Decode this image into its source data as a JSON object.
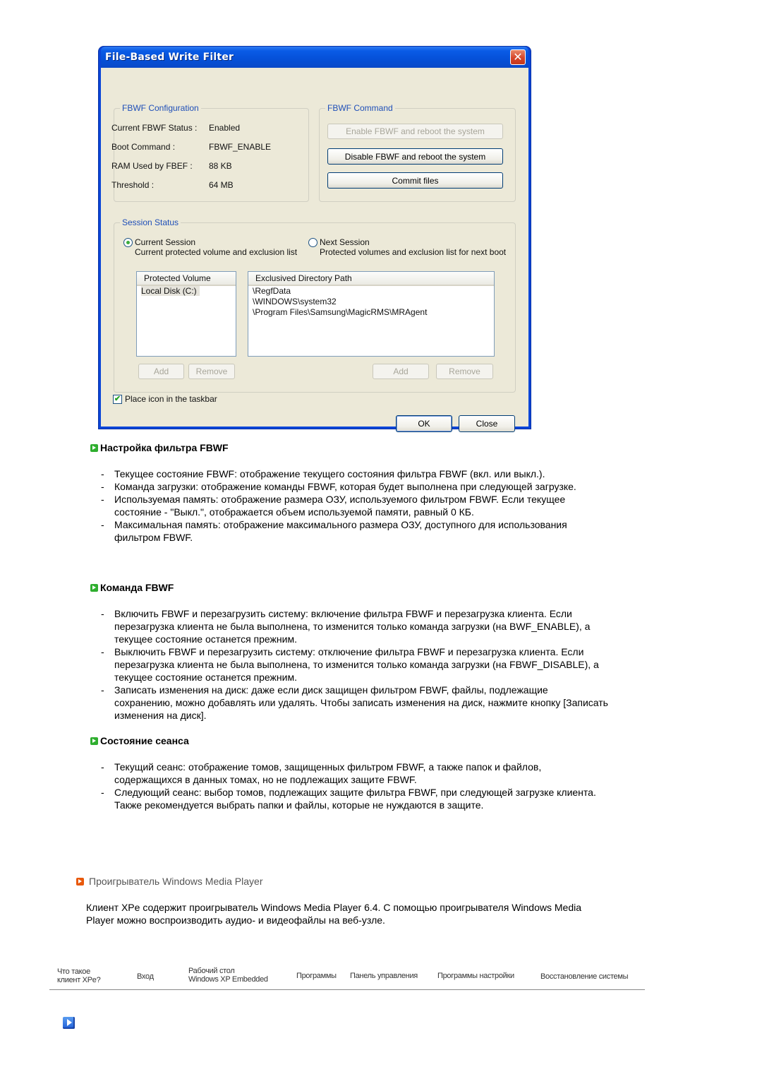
{
  "window": {
    "title": "File-Based Write Filter",
    "close_icon": "close-icon",
    "config": {
      "legend": "FBWF Configuration",
      "rows": [
        {
          "label": "Current FBWF Status :",
          "value": "Enabled"
        },
        {
          "label": "Boot Command :",
          "value": "FBWF_ENABLE"
        },
        {
          "label": "RAM Used by FBEF :",
          "value": "88 KB"
        },
        {
          "label": "Threshold :",
          "value": "64 MB"
        }
      ]
    },
    "command": {
      "legend": "FBWF Command",
      "enable_label": "Enable FBWF and reboot the system",
      "disable_label": "Disable FBWF and reboot the system",
      "commit_label": "Commit files"
    },
    "session": {
      "legend": "Session Status",
      "current_label": "Current Session",
      "current_desc": "Current  protected volume and exclusion list",
      "next_label": "Next Session",
      "next_desc": "Protected volumes and exclusion list for next boot",
      "selected": "current",
      "volume_header": "Protected Volume",
      "volumes": [
        "Local Disk (C:)"
      ],
      "path_header": "Exclusived Directory Path",
      "paths": [
        "\\RegfData",
        "\\WINDOWS\\system32",
        "\\Program Files\\Samsung\\MagicRMS\\MRAgent"
      ],
      "add_label": "Add",
      "remove_label": "Remove"
    },
    "taskbar_checkbox": {
      "label": "Place icon in the taskbar",
      "checked": true
    },
    "ok_label": "OK",
    "close_label": "Close"
  },
  "sections": [
    {
      "title": "Настройка фильтра FBWF",
      "items": [
        "Текущее состояние FBWF: отображение текущего состояния фильтра FBWF (вкл. или выкл.).",
        "Команда загрузки: отображение команды FBWF, которая будет выполнена при следующей загрузке.",
        "Используемая память: отображение размера ОЗУ, используемого фильтром FBWF. Если текущее состояние - \"Выкл.\", отображается объем используемой памяти, равный 0 КБ.",
        "Максимальная память: отображение максимального размера ОЗУ, доступного для использования фильтром FBWF."
      ]
    },
    {
      "title": "Команда FBWF",
      "items": [
        "Включить FBWF и перезагрузить систему: включение фильтра FBWF и перезагрузка клиента. Если перезагрузка клиента не была выполнена, то изменится только команда загрузки (на BWF_ENABLE), а текущее состояние останется прежним.",
        "Выключить FBWF и перезагрузить систему: отключение фильтра FBWF и перезагрузка клиента. Если перезагрузка клиента не была выполнена, то изменится только команда загрузки (на FBWF_DISABLE), а текущее состояние останется прежним.",
        "Записать изменения на диск: даже если диск защищен фильтром FBWF, файлы, подлежащие сохранению, можно добавлять или удалять. Чтобы записать изменения на диск, нажмите кнопку [Записать изменения на диск]."
      ]
    },
    {
      "title": "Состояние сеанса",
      "items": [
        "Текущий сеанс: отображение томов, защищенных фильтром FBWF, а также папок и файлов, содержащихся в данных томах, но не подлежащих защите FBWF.",
        "Следующий сеанс: выбор томов, подлежащих защите фильтра FBWF, при следующей загрузке клиента. Также рекомендуется выбрать папки и файлы, которые не нуждаются в защите."
      ]
    }
  ],
  "wmp": {
    "title": "Проигрыватель Windows Media Player",
    "text": "Клиент XPe содержит проигрыватель Windows Media Player 6.4. С помощью проигрывателя Windows Media Player можно воспроизводить аудио- и видеофайлы на веб-узле."
  },
  "nav": {
    "items": [
      {
        "line1": "Что такое",
        "line2": "клиент XPe?"
      },
      {
        "line1": "Вход",
        "line2": ""
      },
      {
        "line1": "Рабочий стол",
        "line2": "Windows XP Embedded"
      },
      {
        "line1": "Программы",
        "line2": ""
      },
      {
        "line1": "Панель управления",
        "line2": ""
      },
      {
        "line1": "Программы настройки",
        "line2": ""
      },
      {
        "line1": "Восстановление системы",
        "line2": ""
      }
    ]
  },
  "colors": {
    "title_bar": "#0a5ce6",
    "dialog_bg": "#ece9d8",
    "legend_blue": "#1f4fb8",
    "section_icon_green": "#2fae2f",
    "wmp_icon_orange": "#e8590c"
  }
}
